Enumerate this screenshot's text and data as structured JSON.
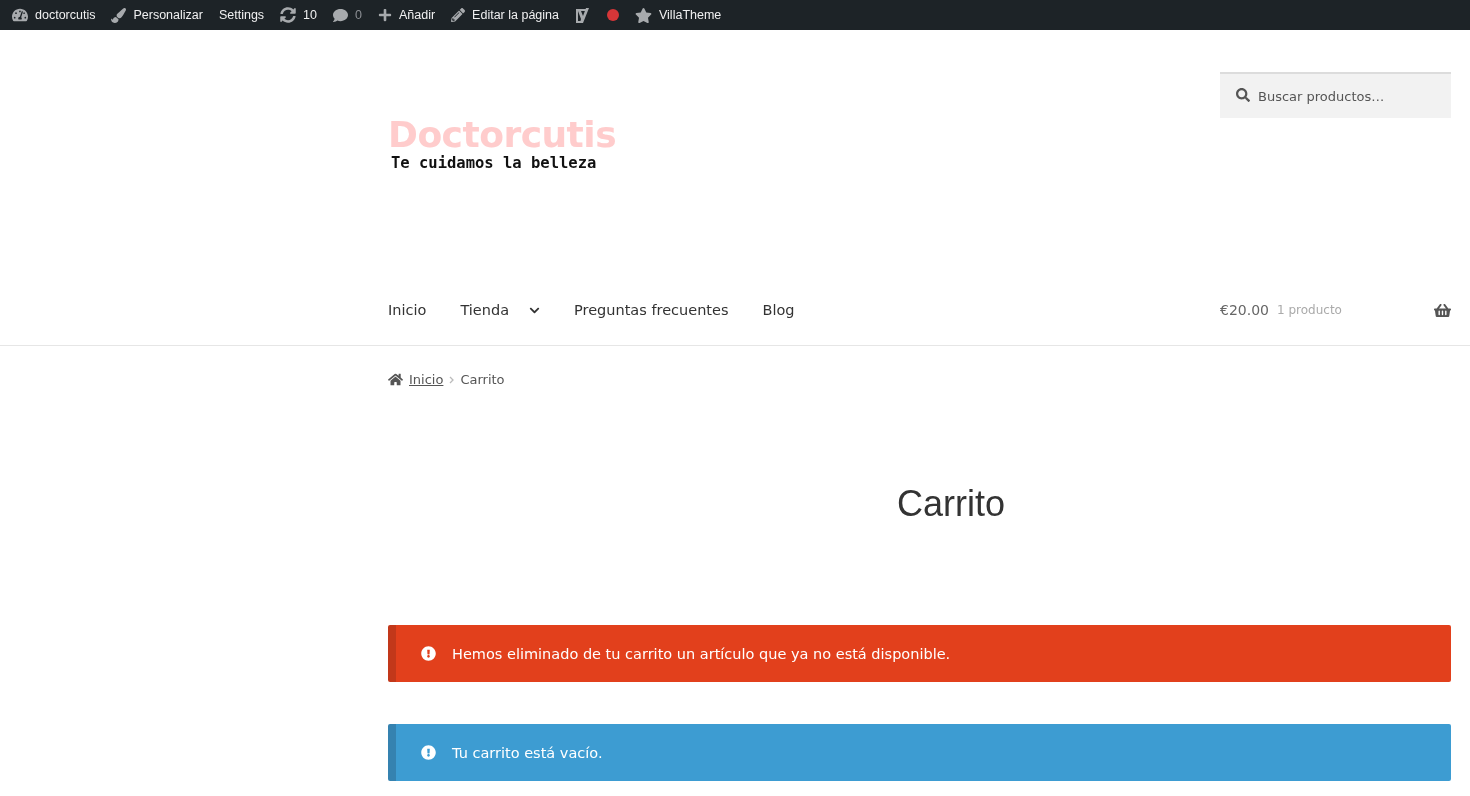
{
  "admin_bar": [
    {
      "kind": "dashboard",
      "label": "doctorcutis"
    },
    {
      "kind": "brush",
      "label": "Personalizar"
    },
    {
      "kind": "text",
      "label": "Settings"
    },
    {
      "kind": "updates",
      "label": "10"
    },
    {
      "kind": "comments",
      "label": "0"
    },
    {
      "kind": "plus",
      "label": "Añadir"
    },
    {
      "kind": "pencil",
      "label": "Editar la página"
    },
    {
      "kind": "seo"
    },
    {
      "kind": "dot",
      "color": "#d63638"
    },
    {
      "kind": "star",
      "label": "VillaTheme"
    }
  ],
  "site": {
    "title": "Doctorcutis",
    "tagline": "Te cuidamos la belleza"
  },
  "search": {
    "placeholder": "Buscar productos…"
  },
  "nav": [
    {
      "label": "Inicio",
      "has_submenu": false
    },
    {
      "label": "Tienda",
      "has_submenu": true
    },
    {
      "label": "Preguntas frecuentes",
      "has_submenu": false
    },
    {
      "label": "Blog",
      "has_submenu": false
    }
  ],
  "cart": {
    "total": "€20.00",
    "count": "1 producto"
  },
  "breadcrumb": {
    "home": "Inicio",
    "current": "Carrito"
  },
  "page_title": "Carrito",
  "notices": [
    {
      "kind": "error",
      "text": "Hemos eliminado de tu carrito un artículo que ya no está disponible."
    },
    {
      "kind": "info",
      "text": "Tu carrito está vacío."
    }
  ]
}
